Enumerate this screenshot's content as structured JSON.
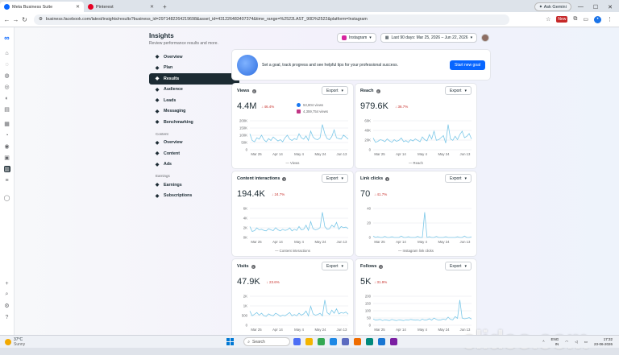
{
  "browser": {
    "tabs": [
      {
        "title": "Meta Business Suite",
        "active": true
      },
      {
        "title": "Pinterest",
        "active": false
      }
    ],
    "new_tab": "+",
    "ask_gemini": "Ask Gemini",
    "url": "business.facebook.com/latest/insights/results?business_id=2971482264219698&asset_id=431226483407374&time_range=%2522LAST_90D%2522&platform=Instagram",
    "badge": "New"
  },
  "insights": {
    "title": "Insights",
    "subtitle": "Review performance results and more.",
    "platform": "Instagram",
    "date_range": "Last 90 days: Mar 25, 2026 – Jun 22, 2026"
  },
  "menu": {
    "items": [
      {
        "label": "Overview",
        "icon": "overview-icon"
      },
      {
        "label": "Plan",
        "icon": "plan-icon"
      },
      {
        "label": "Results",
        "icon": "results-icon",
        "selected": true
      },
      {
        "label": "Audience",
        "icon": "audience-icon"
      },
      {
        "label": "Leads",
        "icon": "leads-icon"
      },
      {
        "label": "Messaging",
        "icon": "messaging-icon"
      },
      {
        "label": "Benchmarking",
        "icon": "benchmarking-icon"
      }
    ],
    "content_heading": "Content",
    "content_items": [
      {
        "label": "Overview",
        "icon": "overview-icon"
      },
      {
        "label": "Content",
        "icon": "content-icon"
      },
      {
        "label": "Ads",
        "icon": "ads-icon"
      }
    ],
    "earnings_heading": "Earnings",
    "earnings_items": [
      {
        "label": "Earnings",
        "icon": "earnings-icon"
      },
      {
        "label": "Subscriptions",
        "icon": "subscriptions-icon"
      }
    ]
  },
  "goal": {
    "text": "Set a goal, track progress and see helpful tips for your professional success.",
    "button": "Start new goal"
  },
  "cards": [
    {
      "title": "Views",
      "value": "4.4M",
      "change": "↓ 46.4%",
      "export": "Export",
      "legend": "Views",
      "sub1": "53,804 views",
      "sub2": "4,359,754 views",
      "yticks": [
        "200K",
        "150K",
        "100K",
        "50K",
        "0"
      ],
      "xticks": [
        "Mar 25",
        "Apr 14",
        "May 4",
        "May 24",
        "Jun 13"
      ],
      "series": [
        60,
        35,
        30,
        45,
        40,
        55,
        38,
        30,
        42,
        35,
        48,
        40,
        33,
        38,
        30,
        45,
        55,
        40,
        35,
        42,
        38,
        60,
        45,
        40,
        52,
        35,
        70,
        48,
        40,
        38,
        45,
        95,
        60,
        42,
        38,
        50,
        75,
        45,
        42,
        40,
        55,
        48,
        40
      ]
    },
    {
      "title": "Reach",
      "value": "979.6K",
      "change": "↓ 36.7%",
      "export": "Export",
      "legend": "Reach",
      "yticks": [
        "60K",
        "40K",
        "20K",
        "0"
      ],
      "xticks": [
        "Mar 25",
        "Apr 14",
        "May 4",
        "May 24",
        "Jun 13"
      ],
      "series": [
        35,
        22,
        25,
        30,
        28,
        24,
        32,
        26,
        22,
        30,
        25,
        28,
        35,
        24,
        27,
        22,
        30,
        26,
        32,
        28,
        24,
        38,
        30,
        26,
        45,
        32,
        55,
        28,
        30,
        36,
        42,
        20,
        75,
        32,
        28,
        40,
        30,
        45,
        55,
        36,
        40,
        48,
        32
      ]
    },
    {
      "title": "Content interactions",
      "value": "194.4K",
      "change": "↓ 24.7%",
      "export": "Export",
      "legend": "Content interactions",
      "yticks": [
        "6K",
        "4K",
        "2K",
        "0K"
      ],
      "xticks": [
        "Mar 25",
        "Apr 14",
        "May 4",
        "May 24",
        "Jun 13"
      ],
      "series": [
        40,
        22,
        25,
        35,
        28,
        30,
        26,
        24,
        32,
        28,
        25,
        36,
        28,
        24,
        30,
        26,
        28,
        35,
        24,
        30,
        26,
        40,
        28,
        30,
        45,
        26,
        58,
        32,
        28,
        30,
        36,
        92,
        40,
        30,
        32,
        45,
        38,
        55,
        30,
        40,
        36,
        38,
        32
      ]
    },
    {
      "title": "Link clicks",
      "value": "70",
      "change": "↓ 41.7%",
      "export": "Export",
      "legend": "Instagram link clicks",
      "yticks": [
        "40",
        "20",
        "0"
      ],
      "xticks": [
        "Mar 25",
        "Apr 14",
        "May 4",
        "May 24",
        "Jun 13"
      ],
      "series": [
        4,
        0,
        2,
        0,
        0,
        3,
        0,
        0,
        2,
        0,
        0,
        0,
        4,
        0,
        0,
        2,
        0,
        0,
        0,
        3,
        0,
        0,
        70,
        0,
        2,
        0,
        0,
        3,
        0,
        0,
        0,
        2,
        0,
        0,
        0,
        0,
        2,
        0,
        0,
        4,
        0,
        0,
        2
      ]
    },
    {
      "title": "Visits",
      "value": "47.9K",
      "change": "↓ 23.6%",
      "export": "Export",
      "legend": "Visits",
      "yticks": [
        "2K",
        "1K",
        "500",
        "0"
      ],
      "xticks": [
        "Mar 25",
        "Apr 14",
        "May 4",
        "May 24",
        "Jun 13"
      ],
      "series": [
        45,
        30,
        35,
        40,
        32,
        38,
        30,
        28,
        36,
        32,
        30,
        38,
        34,
        28,
        32,
        30,
        35,
        40,
        30,
        34,
        30,
        38,
        32,
        36,
        45,
        30,
        60,
        36,
        32,
        34,
        38,
        30,
        80,
        40,
        34,
        48,
        38,
        52,
        36,
        40,
        38,
        42,
        35
      ]
    },
    {
      "title": "Follows",
      "value": "5K",
      "change": "↓ 31.9%",
      "export": "Export",
      "legend": "Follows",
      "yticks": [
        "200",
        "150",
        "100",
        "50",
        "0"
      ],
      "xticks": [
        "Mar 25",
        "Apr 14",
        "May 4",
        "May 24",
        "Jun 13"
      ],
      "series": [
        35,
        28,
        30,
        32,
        26,
        30,
        28,
        26,
        32,
        28,
        26,
        30,
        28,
        26,
        30,
        28,
        32,
        30,
        28,
        30,
        26,
        34,
        28,
        30,
        36,
        28,
        40,
        32,
        28,
        30,
        34,
        30,
        45,
        32,
        30,
        48,
        38,
        140,
        40,
        36,
        38,
        42,
        34
      ]
    }
  ],
  "taskbar": {
    "temp": "37°C",
    "weather": "Sunny",
    "search": "Search",
    "lang1": "ENG",
    "lang2": "IN",
    "time": "17:32",
    "date": "23-06-2026"
  },
  "watermark": "clideo.com",
  "colors": {
    "accent": "#0866ff",
    "line": "#7cc8e8",
    "down": "#c8332e",
    "dark": "#1c2b33"
  }
}
